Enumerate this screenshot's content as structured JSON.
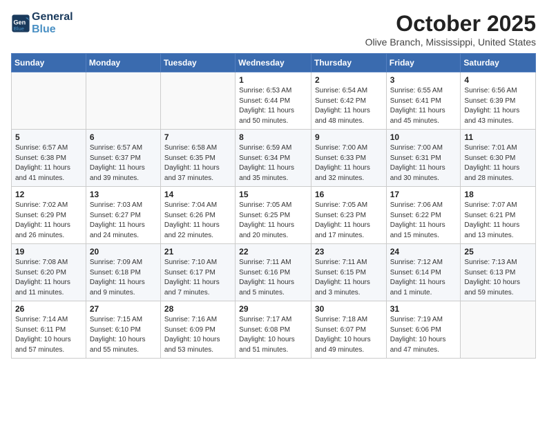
{
  "header": {
    "logo_line1": "General",
    "logo_line2": "Blue",
    "month": "October 2025",
    "location": "Olive Branch, Mississippi, United States"
  },
  "weekdays": [
    "Sunday",
    "Monday",
    "Tuesday",
    "Wednesday",
    "Thursday",
    "Friday",
    "Saturday"
  ],
  "weeks": [
    [
      {
        "day": "",
        "info": ""
      },
      {
        "day": "",
        "info": ""
      },
      {
        "day": "",
        "info": ""
      },
      {
        "day": "1",
        "info": "Sunrise: 6:53 AM\nSunset: 6:44 PM\nDaylight: 11 hours\nand 50 minutes."
      },
      {
        "day": "2",
        "info": "Sunrise: 6:54 AM\nSunset: 6:42 PM\nDaylight: 11 hours\nand 48 minutes."
      },
      {
        "day": "3",
        "info": "Sunrise: 6:55 AM\nSunset: 6:41 PM\nDaylight: 11 hours\nand 45 minutes."
      },
      {
        "day": "4",
        "info": "Sunrise: 6:56 AM\nSunset: 6:39 PM\nDaylight: 11 hours\nand 43 minutes."
      }
    ],
    [
      {
        "day": "5",
        "info": "Sunrise: 6:57 AM\nSunset: 6:38 PM\nDaylight: 11 hours\nand 41 minutes."
      },
      {
        "day": "6",
        "info": "Sunrise: 6:57 AM\nSunset: 6:37 PM\nDaylight: 11 hours\nand 39 minutes."
      },
      {
        "day": "7",
        "info": "Sunrise: 6:58 AM\nSunset: 6:35 PM\nDaylight: 11 hours\nand 37 minutes."
      },
      {
        "day": "8",
        "info": "Sunrise: 6:59 AM\nSunset: 6:34 PM\nDaylight: 11 hours\nand 35 minutes."
      },
      {
        "day": "9",
        "info": "Sunrise: 7:00 AM\nSunset: 6:33 PM\nDaylight: 11 hours\nand 32 minutes."
      },
      {
        "day": "10",
        "info": "Sunrise: 7:00 AM\nSunset: 6:31 PM\nDaylight: 11 hours\nand 30 minutes."
      },
      {
        "day": "11",
        "info": "Sunrise: 7:01 AM\nSunset: 6:30 PM\nDaylight: 11 hours\nand 28 minutes."
      }
    ],
    [
      {
        "day": "12",
        "info": "Sunrise: 7:02 AM\nSunset: 6:29 PM\nDaylight: 11 hours\nand 26 minutes."
      },
      {
        "day": "13",
        "info": "Sunrise: 7:03 AM\nSunset: 6:27 PM\nDaylight: 11 hours\nand 24 minutes."
      },
      {
        "day": "14",
        "info": "Sunrise: 7:04 AM\nSunset: 6:26 PM\nDaylight: 11 hours\nand 22 minutes."
      },
      {
        "day": "15",
        "info": "Sunrise: 7:05 AM\nSunset: 6:25 PM\nDaylight: 11 hours\nand 20 minutes."
      },
      {
        "day": "16",
        "info": "Sunrise: 7:05 AM\nSunset: 6:23 PM\nDaylight: 11 hours\nand 17 minutes."
      },
      {
        "day": "17",
        "info": "Sunrise: 7:06 AM\nSunset: 6:22 PM\nDaylight: 11 hours\nand 15 minutes."
      },
      {
        "day": "18",
        "info": "Sunrise: 7:07 AM\nSunset: 6:21 PM\nDaylight: 11 hours\nand 13 minutes."
      }
    ],
    [
      {
        "day": "19",
        "info": "Sunrise: 7:08 AM\nSunset: 6:20 PM\nDaylight: 11 hours\nand 11 minutes."
      },
      {
        "day": "20",
        "info": "Sunrise: 7:09 AM\nSunset: 6:18 PM\nDaylight: 11 hours\nand 9 minutes."
      },
      {
        "day": "21",
        "info": "Sunrise: 7:10 AM\nSunset: 6:17 PM\nDaylight: 11 hours\nand 7 minutes."
      },
      {
        "day": "22",
        "info": "Sunrise: 7:11 AM\nSunset: 6:16 PM\nDaylight: 11 hours\nand 5 minutes."
      },
      {
        "day": "23",
        "info": "Sunrise: 7:11 AM\nSunset: 6:15 PM\nDaylight: 11 hours\nand 3 minutes."
      },
      {
        "day": "24",
        "info": "Sunrise: 7:12 AM\nSunset: 6:14 PM\nDaylight: 11 hours\nand 1 minute."
      },
      {
        "day": "25",
        "info": "Sunrise: 7:13 AM\nSunset: 6:13 PM\nDaylight: 10 hours\nand 59 minutes."
      }
    ],
    [
      {
        "day": "26",
        "info": "Sunrise: 7:14 AM\nSunset: 6:11 PM\nDaylight: 10 hours\nand 57 minutes."
      },
      {
        "day": "27",
        "info": "Sunrise: 7:15 AM\nSunset: 6:10 PM\nDaylight: 10 hours\nand 55 minutes."
      },
      {
        "day": "28",
        "info": "Sunrise: 7:16 AM\nSunset: 6:09 PM\nDaylight: 10 hours\nand 53 minutes."
      },
      {
        "day": "29",
        "info": "Sunrise: 7:17 AM\nSunset: 6:08 PM\nDaylight: 10 hours\nand 51 minutes."
      },
      {
        "day": "30",
        "info": "Sunrise: 7:18 AM\nSunset: 6:07 PM\nDaylight: 10 hours\nand 49 minutes."
      },
      {
        "day": "31",
        "info": "Sunrise: 7:19 AM\nSunset: 6:06 PM\nDaylight: 10 hours\nand 47 minutes."
      },
      {
        "day": "",
        "info": ""
      }
    ]
  ]
}
